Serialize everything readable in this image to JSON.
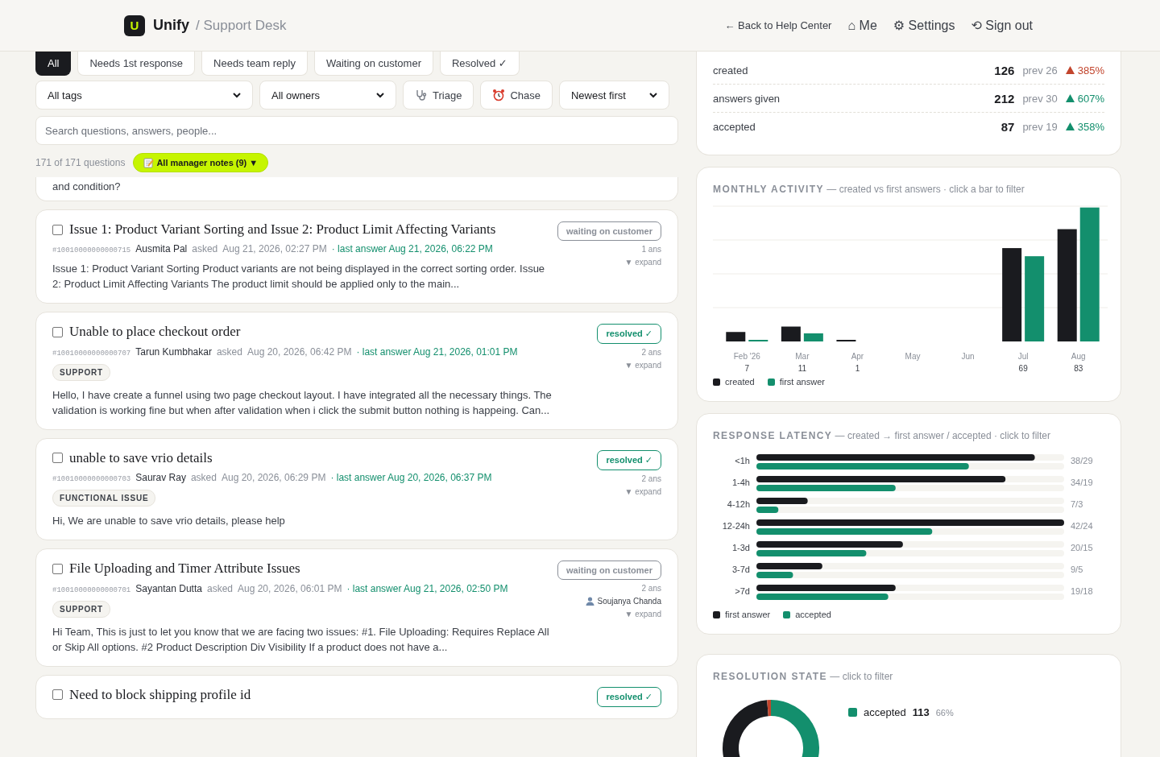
{
  "header": {
    "logo_letter": "U",
    "brand": "Unify",
    "section": "/ Support Desk",
    "nav": [
      {
        "kind": "back",
        "icon": "←",
        "label": "Back to Help Center"
      },
      {
        "kind": "main",
        "icon": "⌂",
        "label": "Me"
      },
      {
        "kind": "main",
        "icon": "⚙",
        "label": "Settings"
      },
      {
        "kind": "main",
        "icon": "⟲",
        "label": "Sign out"
      }
    ]
  },
  "filters": {
    "tabs": [
      {
        "label": "All",
        "selected": true
      },
      {
        "label": "Needs 1st response",
        "selected": false
      },
      {
        "label": "Needs team reply",
        "selected": false
      },
      {
        "label": "Waiting on customer",
        "selected": false
      },
      {
        "label": "Resolved ✓",
        "selected": false
      }
    ],
    "controls": [
      {
        "kind": "select",
        "label": "All tags"
      },
      {
        "kind": "select",
        "label": "All owners"
      },
      {
        "kind": "triage",
        "label": "Triage"
      },
      {
        "kind": "chase",
        "label": "Chase"
      },
      {
        "kind": "select",
        "label": "Newest first"
      }
    ],
    "search": {
      "placeholder": "Search questions, answers, people..."
    },
    "count": "171 of 171 questions",
    "notes_chip": "All manager notes (9) ▼"
  },
  "questions": [
    {
      "kind": "fragment",
      "excerpt": "and condition?"
    },
    {
      "kind": "full",
      "checked": false,
      "title": "Issue 1: Product Variant Sorting and Issue 2: Product Limit Affecting Variants",
      "status": {
        "kind": "waiting",
        "label": "waiting on customer"
      },
      "id": "#10010000000000715",
      "author": "Ausmita Pal",
      "asked": "asked",
      "date": "Aug 21, 2026, 02:27 PM",
      "last_answer": "· last answer Aug 21, 2026, 06:22 PM",
      "answers": "1 ans",
      "expand": "▼ expand",
      "excerpt": "Issue 1: Product Variant Sorting Product variants are not being displayed in the correct sorting order. Issue 2: Product Limit Affecting Variants The product limit should be applied only to the main..."
    },
    {
      "kind": "full",
      "checked": false,
      "title": "Unable to place checkout order",
      "status": {
        "kind": "resolved",
        "label": "resolved ✓"
      },
      "id": "#10010000000000707",
      "author": "Tarun Kumbhakar",
      "asked": "asked",
      "date": "Aug 20, 2026, 06:42 PM",
      "last_answer": "· last answer Aug 21, 2026, 01:01 PM",
      "answers": "2 ans",
      "expand": "▼ expand",
      "tags": [
        "SUPPORT"
      ],
      "excerpt": "Hello, I have create a funnel using two page checkout layout. I have integrated all the necessary things. The validation is working fine but when after validation when i click the submit button nothing is happeing. Can..."
    },
    {
      "kind": "full",
      "checked": false,
      "title": "unable to save vrio details",
      "status": {
        "kind": "resolved",
        "label": "resolved ✓"
      },
      "id": "#10010000000000703",
      "author": "Saurav Ray",
      "asked": "asked",
      "date": "Aug 20, 2026, 06:29 PM",
      "last_answer": "· last answer Aug 20, 2026, 06:37 PM",
      "answers": "2 ans",
      "expand": "▼ expand",
      "tags": [
        "FUNCTIONAL ISSUE"
      ],
      "excerpt": "Hi, We are unable to save vrio details, please help"
    },
    {
      "kind": "full",
      "checked": false,
      "title": "File Uploading and Timer Attribute Issues",
      "status": {
        "kind": "waiting",
        "label": "waiting on customer"
      },
      "id": "#10010000000000701",
      "author": "Sayantan Dutta",
      "asked": "asked",
      "date": "Aug 20, 2026, 06:01 PM",
      "last_answer": "· last answer Aug 21, 2026, 02:50 PM",
      "answers": "2 ans",
      "assignee": "Soujanya Chanda",
      "expand": "▼ expand",
      "tags": [
        "SUPPORT"
      ],
      "excerpt": "Hi Team, This is just to let you know that we are facing two issues: #1. File Uploading: Requires Replace All or Skip All options. #2 Product Description Div Visibility If a product does not have a..."
    },
    {
      "kind": "full",
      "checked": false,
      "title": "Need to block shipping profile id",
      "status": {
        "kind": "resolved",
        "label": "resolved ✓"
      }
    }
  ],
  "stats": [
    {
      "label": "created",
      "value": "126",
      "prev": "prev 26",
      "change": "385%",
      "color": "#c2452d"
    },
    {
      "label": "answers given",
      "value": "212",
      "prev": "prev 30",
      "change": "607%",
      "color": "#138f6d"
    },
    {
      "label": "accepted",
      "value": "87",
      "prev": "prev 19",
      "change": "358%",
      "color": "#138f6d"
    }
  ],
  "monthly": {
    "title": "MONTHLY ACTIVITY",
    "subtitle": "— created vs first answers · click a bar to filter",
    "months": [
      {
        "label": "Feb '26",
        "count": "7"
      },
      {
        "label": "Mar",
        "count": "11"
      },
      {
        "label": "Apr",
        "count": "1"
      },
      {
        "label": "May"
      },
      {
        "label": "Jun"
      },
      {
        "label": "Jul",
        "count": "69"
      },
      {
        "label": "Aug",
        "count": "83"
      }
    ],
    "legend": [
      {
        "label": "created",
        "color": "#1a1b1f"
      },
      {
        "label": "first answer",
        "color": "#138f6d"
      }
    ]
  },
  "latency": {
    "title": "RESPONSE LATENCY",
    "subtitle": "— created → first answer / accepted · click to filter",
    "rows": [
      {
        "label": "<1h",
        "reading": "38/29"
      },
      {
        "label": "1-4h",
        "reading": "34/19"
      },
      {
        "label": "4-12h",
        "reading": "7/3"
      },
      {
        "label": "12-24h",
        "reading": "42/24"
      },
      {
        "label": "1-3d",
        "reading": "20/15"
      },
      {
        "label": "3-7d",
        "reading": "9/5"
      },
      {
        "label": ">7d",
        "reading": "19/18"
      }
    ],
    "legend": [
      {
        "label": "first answer",
        "color": "#1a1b1f"
      },
      {
        "label": "accepted",
        "color": "#138f6d"
      }
    ]
  },
  "resolution": {
    "title": "RESOLUTION STATE",
    "subtitle": "— click to filter",
    "legend": [
      {
        "label": "accepted",
        "value": "113",
        "share": "66%",
        "color": "#138f6d"
      }
    ]
  }
}
